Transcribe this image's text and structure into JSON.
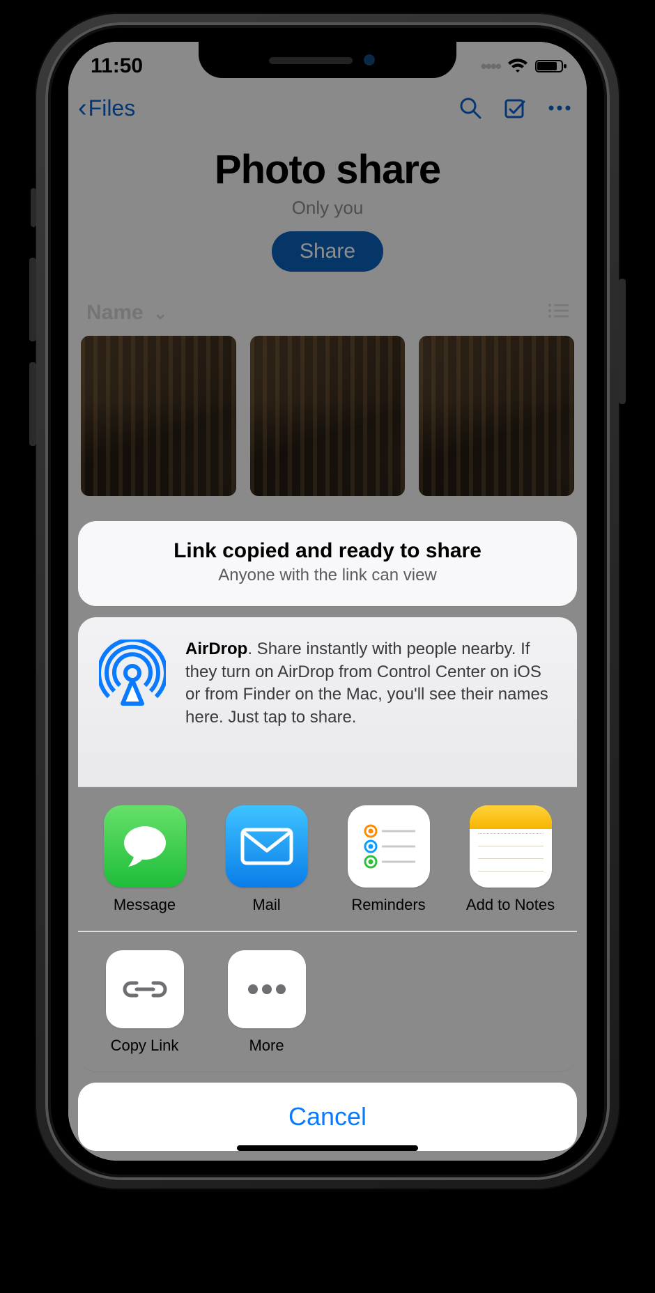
{
  "status": {
    "time": "11:50"
  },
  "nav": {
    "back_label": "Files"
  },
  "page": {
    "title": "Photo share",
    "subtitle": "Only you",
    "share_button": "Share",
    "sort_label": "Name"
  },
  "share_sheet": {
    "copied": {
      "title": "Link copied and ready to share",
      "subtitle": "Anyone with the link can view"
    },
    "airdrop": {
      "title": "AirDrop",
      "body": ". Share instantly with people nearby. If they turn on AirDrop from Control Center on iOS or from Finder on the Mac, you'll see their names here. Just tap to share."
    },
    "apps": [
      {
        "label": "Message"
      },
      {
        "label": "Mail"
      },
      {
        "label": "Reminders"
      },
      {
        "label": "Add to Notes"
      }
    ],
    "actions": [
      {
        "label": "Copy Link"
      },
      {
        "label": "More"
      }
    ],
    "cancel": "Cancel"
  }
}
